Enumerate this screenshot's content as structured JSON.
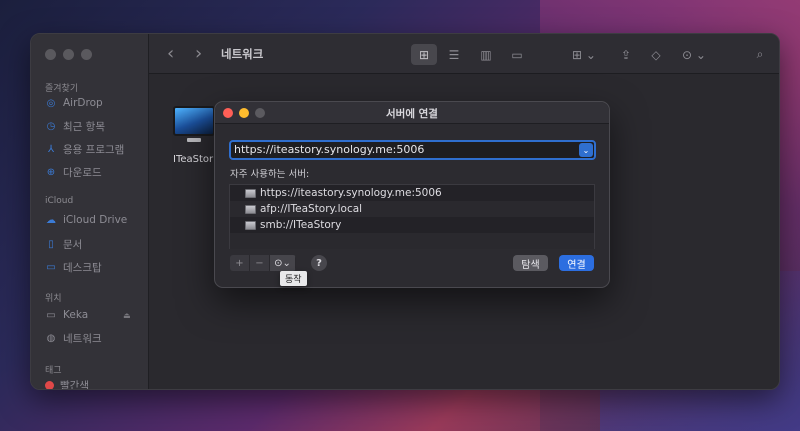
{
  "finder": {
    "title": "네트워크",
    "nav": {
      "back_icon": "chevron-left-icon",
      "forward_icon": "chevron-right-icon"
    },
    "sidebar": {
      "favorites_header": "즐겨찾기",
      "favorites": [
        {
          "label": "AirDrop",
          "icon": "airdrop-icon"
        },
        {
          "label": "최근 항목",
          "icon": "clock-icon"
        },
        {
          "label": "응용 프로그램",
          "icon": "applications-icon"
        },
        {
          "label": "다운로드",
          "icon": "download-icon"
        }
      ],
      "icloud_header": "iCloud",
      "icloud": [
        {
          "label": "iCloud Drive",
          "icon": "cloud-icon"
        },
        {
          "label": "문서",
          "icon": "document-icon"
        },
        {
          "label": "데스크탑",
          "icon": "desktop-icon"
        }
      ],
      "locations_header": "위치",
      "locations": [
        {
          "label": "Keka",
          "icon": "drive-icon"
        },
        {
          "label": "네트워크",
          "icon": "network-icon"
        }
      ],
      "tags_header": "태그",
      "tags": [
        {
          "label": "빨간색",
          "color": "#e04848"
        }
      ]
    },
    "items": [
      {
        "label": "ITeaStor"
      }
    ]
  },
  "dialog": {
    "title": "서버에 연결",
    "address_value": "https://iteastory.synology.me:5006",
    "favorites_label": "자주 사용하는 서버:",
    "favorite_servers": [
      "https://iteastory.synology.me:5006",
      "afp://ITeaStory.local",
      "smb://ITeaStory"
    ],
    "add_symbol": "+",
    "remove_symbol": "−",
    "action_symbol": "⊙",
    "help_symbol": "?",
    "browse_label": "탐색",
    "connect_label": "연결"
  },
  "tooltip": "동작",
  "colors": {
    "accent": "#2c6ee0",
    "close": "#ff5f57",
    "minimize": "#febc2e"
  }
}
